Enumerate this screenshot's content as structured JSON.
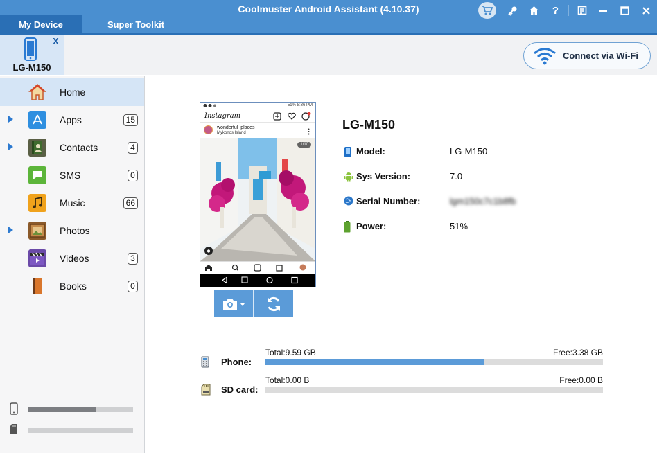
{
  "app": {
    "title": "Coolmuster Android Assistant (4.10.37)",
    "tabs": [
      {
        "label": "My Device",
        "active": true
      },
      {
        "label": "Super Toolkit",
        "active": false
      }
    ],
    "window_icons": [
      "cart-icon",
      "key-icon",
      "home-icon",
      "help-icon",
      "feedback-icon",
      "minimize-icon",
      "maximize-icon",
      "close-icon"
    ],
    "help_glyph": "?",
    "colors": {
      "accent": "#4a8fd0",
      "active_tab": "#2a6fb5",
      "bar_fill": "#5b9bd8"
    }
  },
  "device_tab": {
    "name": "LG-M150",
    "close_label": "X"
  },
  "wifi_button": {
    "label": "Connect via Wi-Fi"
  },
  "sidebar": {
    "items": [
      {
        "label": "Home",
        "count": null,
        "expandable": false,
        "active": true
      },
      {
        "label": "Apps",
        "count": "15",
        "expandable": true
      },
      {
        "label": "Contacts",
        "count": "4",
        "expandable": true
      },
      {
        "label": "SMS",
        "count": "0",
        "expandable": false
      },
      {
        "label": "Music",
        "count": "66",
        "expandable": false
      },
      {
        "label": "Photos",
        "count": null,
        "expandable": true
      },
      {
        "label": "Videos",
        "count": "3",
        "expandable": false
      },
      {
        "label": "Books",
        "count": "0",
        "expandable": false
      }
    ],
    "phone_storage_used_fraction": 0.65,
    "sd_storage_used_fraction": 0.0
  },
  "screen_preview": {
    "statusbar_text": "51% 8:36 PM",
    "app_name": "Instagram",
    "post_user": "wonderful_places",
    "post_location": "Mykonos Island",
    "photo_counter": "1/10"
  },
  "device_info": {
    "title": "LG-M150",
    "rows": [
      {
        "label": "Model:",
        "value": "LG-M150",
        "icon": "phone-icon"
      },
      {
        "label": "Sys Version:",
        "value": "7.0",
        "icon": "android-icon"
      },
      {
        "label": "Serial Number:",
        "value": "lgm150c7c1b8fb",
        "icon": "globe-icon",
        "blurred": true
      },
      {
        "label": "Power:",
        "value": "51%",
        "icon": "battery-icon"
      }
    ]
  },
  "storage": {
    "phone": {
      "label": "Phone:",
      "total": "Total:9.59 GB",
      "free": "Free:3.38 GB",
      "used_fraction": 0.647
    },
    "sd": {
      "label": "SD card:",
      "total": "Total:0.00 B",
      "free": "Free:0.00 B",
      "used_fraction": 0.0
    }
  }
}
